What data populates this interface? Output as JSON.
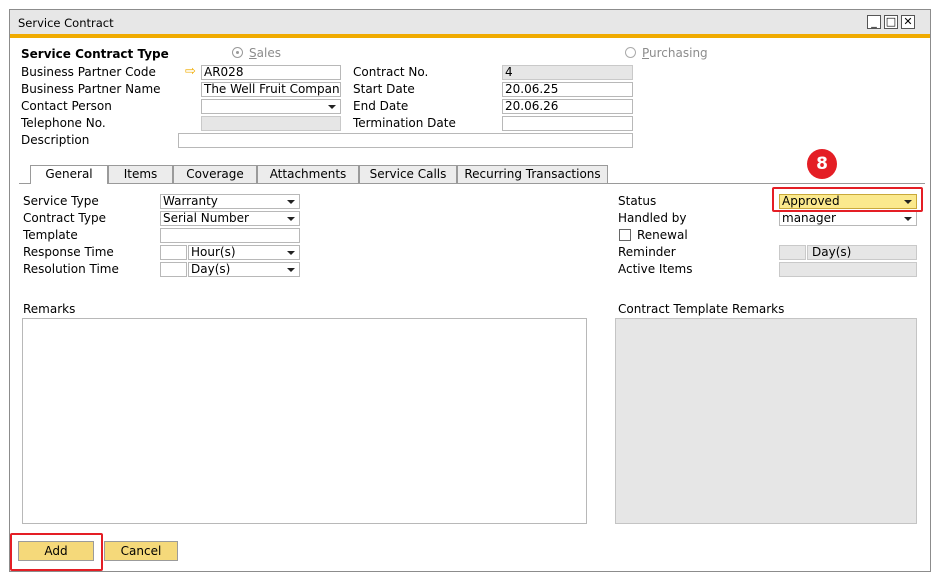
{
  "window": {
    "title": "Service Contract",
    "min_glyph": "_",
    "max_glyph": "□",
    "close_glyph": "✕"
  },
  "header": {
    "service_contract_type_label": "Service Contract Type",
    "sales_label": "Sales",
    "purchasing_label": "Purchasing",
    "bp_code_label": "Business Partner Code",
    "bp_code_value": "AR028",
    "bp_name_label": "Business Partner Name",
    "bp_name_value": "The Well Fruit Company",
    "contact_person_label": "Contact Person",
    "contact_person_value": "",
    "telephone_label": "Telephone No.",
    "description_label": "Description",
    "contract_no_label": "Contract No.",
    "contract_no_value": "4",
    "start_date_label": "Start Date",
    "start_date_value": "20.06.25",
    "end_date_label": "End Date",
    "end_date_value": "20.06.26",
    "termination_date_label": "Termination Date",
    "termination_date_value": ""
  },
  "tabs": [
    "General",
    "Items",
    "Coverage",
    "Attachments",
    "Service Calls",
    "Recurring Transactions"
  ],
  "general": {
    "service_type_label": "Service Type",
    "service_type_value": "Warranty",
    "contract_type_label": "Contract Type",
    "contract_type_value": "Serial Number",
    "template_label": "Template",
    "template_value": "",
    "response_time_label": "Response Time",
    "response_time_unit": "Hour(s)",
    "resolution_time_label": "Resolution Time",
    "resolution_time_unit": "Day(s)",
    "status_label": "Status",
    "status_value": "Approved",
    "handled_by_label": "Handled by",
    "handled_by_value": "manager",
    "renewal_label": "Renewal",
    "reminder_label": "Reminder",
    "reminder_unit": "Day(s)",
    "active_items_label": "Active Items",
    "remarks_label": "Remarks",
    "template_remarks_label": "Contract Template Remarks"
  },
  "callout": {
    "step_number": "8",
    "color": "#e41e25"
  },
  "footer": {
    "add_label": "Add",
    "cancel_label": "Cancel"
  },
  "colors": {
    "accent_bar": "#f0ab00",
    "button": "#f5d97a",
    "status_highlight": "#fbe98d",
    "link_arrow": "#f0ab00"
  }
}
